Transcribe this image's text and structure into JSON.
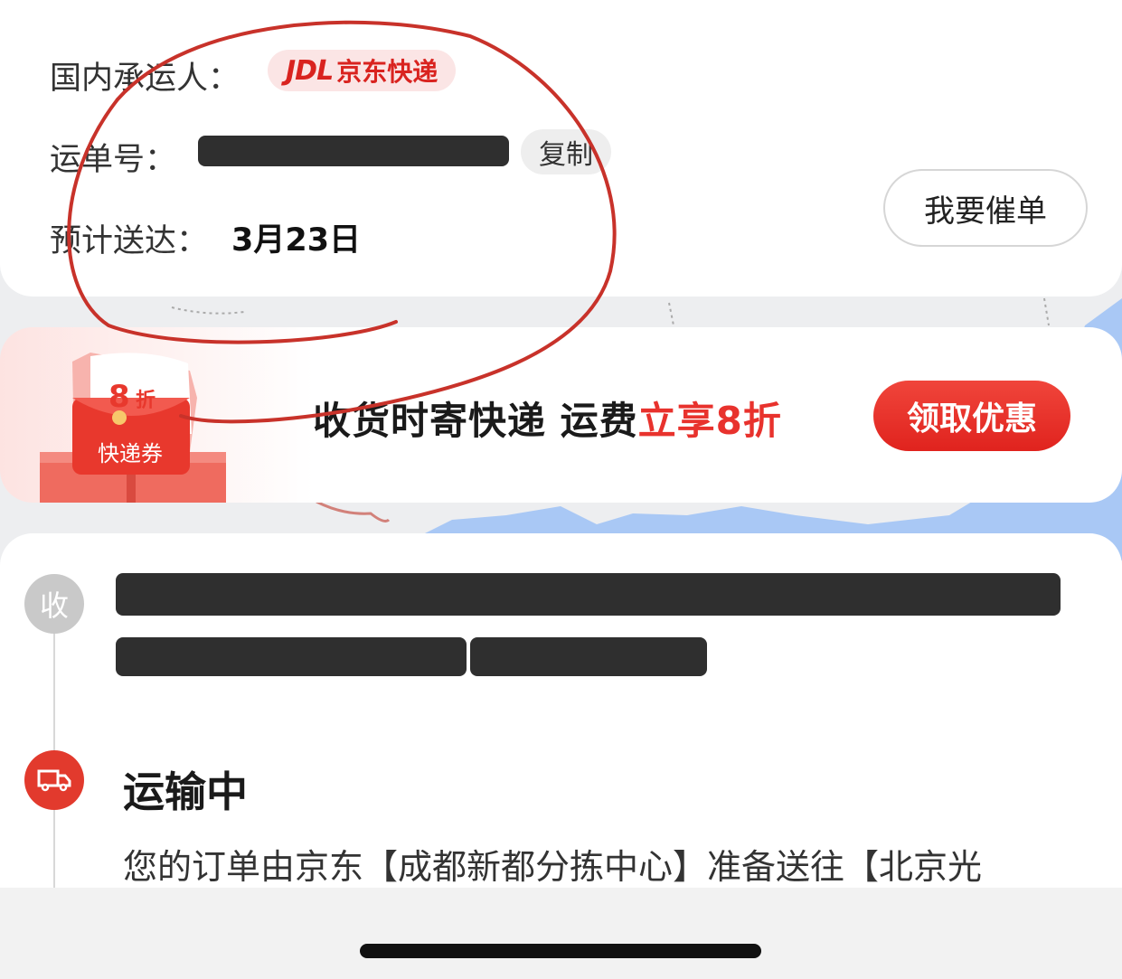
{
  "shipment": {
    "carrier_label": "国内承运人：",
    "carrier_logo_text": "JDL",
    "carrier_name": "京东快递",
    "tracking_label": "运单号：",
    "copy_label": "复制",
    "eta_label": "预计送达：",
    "eta_value": "3月23日",
    "urge_label": "我要催单"
  },
  "promo": {
    "coupon_discount": "8",
    "coupon_unit": "折",
    "coupon_label": "快递券",
    "text_main": "收货时寄快递 运费",
    "text_highlight": "立享8折",
    "claim_label": "领取优惠"
  },
  "tracking": {
    "received_node_label": "收",
    "status_title": "运输中",
    "status_desc": "您的订单由京东【成都新都分拣中心】准备送往【北京光"
  },
  "colors": {
    "accent": "#e23a2d",
    "annotation": "#c8322a"
  }
}
